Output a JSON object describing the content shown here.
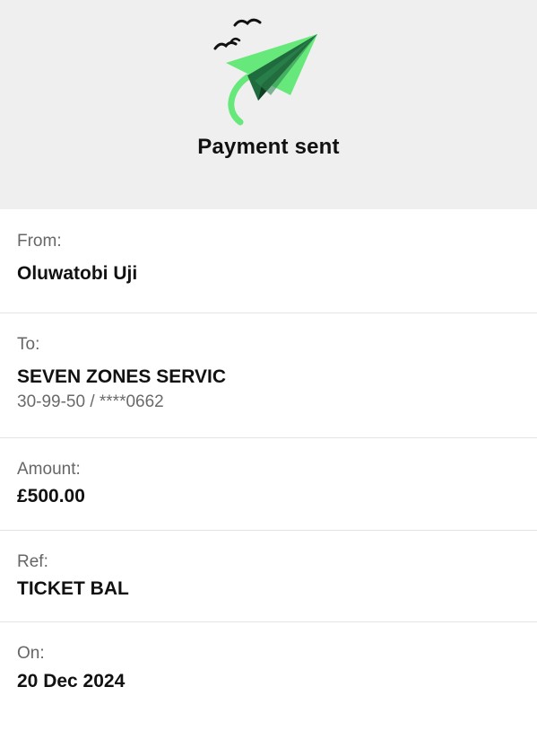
{
  "header": {
    "title": "Payment sent",
    "illustration_icon": "paper-plane-with-birds",
    "plane_colors": {
      "light": "#66e87a",
      "dark": "#1f6b3e",
      "trail": "#66e87a"
    }
  },
  "details": {
    "from": {
      "label": "From:",
      "value": "Oluwatobi Uji"
    },
    "to": {
      "label": "To:",
      "value": "SEVEN ZONES SERVIC",
      "account": "30-99-50 / ****0662"
    },
    "amount": {
      "label": "Amount:",
      "value": "£500.00"
    },
    "ref": {
      "label": "Ref:",
      "value": "TICKET BAL"
    },
    "on": {
      "label": "On:",
      "value": "20 Dec 2024"
    }
  }
}
